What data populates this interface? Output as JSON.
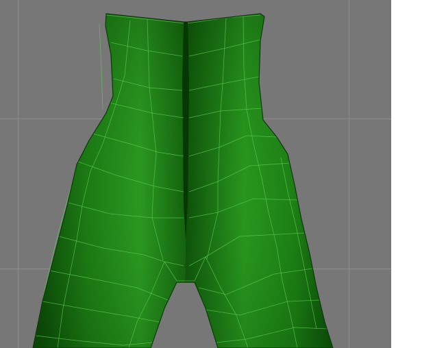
{
  "viewport": {
    "background_color": "#777777",
    "grid_color": "#8e8e8e",
    "model": {
      "type": "low-poly legs mesh (trousers) shown with wireframe edges",
      "fill_dark": "#0a4a06",
      "fill_mid": "#1d7d14",
      "fill_light": "#34a62a",
      "wire_color": "#5fd255"
    }
  },
  "side_panel": {
    "background_color": "#ffffff"
  }
}
